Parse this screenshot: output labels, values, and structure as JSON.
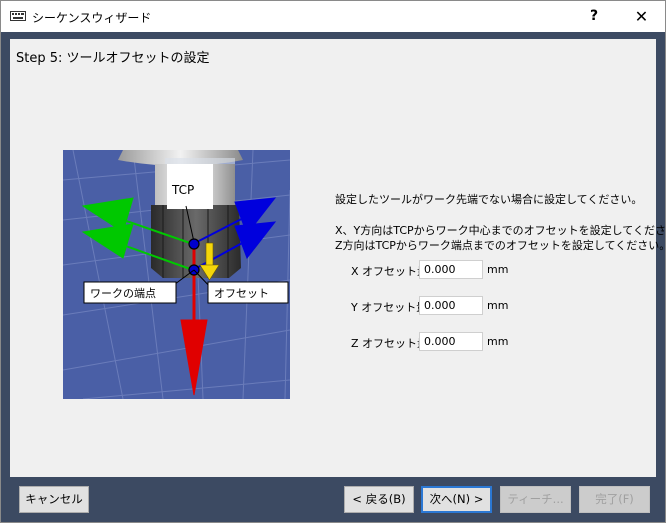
{
  "window": {
    "title": "シーケンスウィザード",
    "help_label": "?",
    "close_label": "✕"
  },
  "step": {
    "title": "Step 5: ツールオフセットの設定"
  },
  "illustration": {
    "tcp_label": "TCP",
    "work_edge_label": "ワークの端点",
    "offset_label": "オフセット"
  },
  "instructions": {
    "line1": "設定したツールがワーク先端でない場合に設定してください。",
    "line2": "X、Y方向はTCPからワーク中心までのオフセットを設定してください。",
    "line3": "Z方向はTCPからワーク端点までのオフセットを設定してください。"
  },
  "fields": [
    {
      "label": "X オフセット量:",
      "value": "0.000",
      "unit": "mm"
    },
    {
      "label": "Y オフセット量:",
      "value": "0.000",
      "unit": "mm"
    },
    {
      "label": "Z オフセット量:",
      "value": "0.000",
      "unit": "mm"
    }
  ],
  "buttons": {
    "cancel": "キャンセル",
    "back": "< 戻る(B)",
    "next": "次へ(N) >",
    "teach": "ティーチ...",
    "finish": "完了(F)"
  },
  "colors": {
    "floor": "#4a5fa6",
    "x_axis": "#e00000",
    "y_axis": "#00c800",
    "z_axis": "#0000dd",
    "offset_arrow": "#f5d60a",
    "frame": "#3c4a62"
  }
}
